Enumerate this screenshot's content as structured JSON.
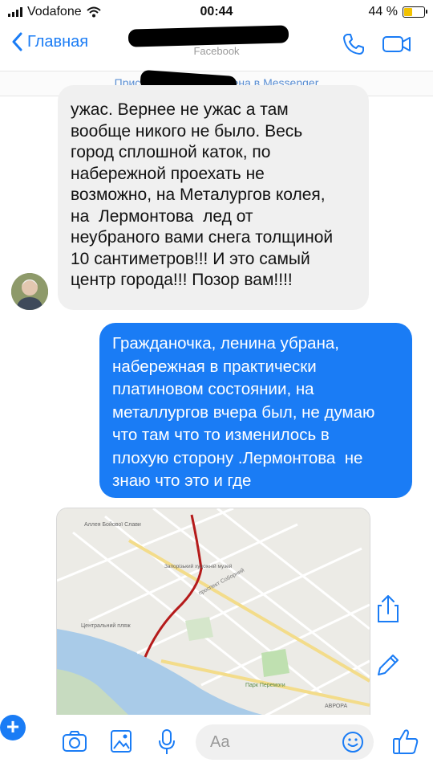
{
  "status_bar": {
    "carrier": "Vodafone",
    "time": "00:44",
    "battery": "44 %",
    "battery_level": 0.44
  },
  "nav": {
    "back_label": "Главная",
    "subtitle": "Facebook"
  },
  "banner": {
    "text": "Присоединяйтесь к Елена в Messenger"
  },
  "messages": {
    "incoming": [
      "ужас. Вернее не ужас а там",
      "вообще никого не было. Весь",
      "город сплошной каток, по",
      "набережной проехать не",
      "возможно, на Металургов колея,",
      "на  Лермонтова  лед от",
      "неубраного вами снега толщиной",
      "10 сантиметров!!! И это самый",
      "центр города!!! Позор вам!!!!"
    ],
    "outgoing": [
      "Гражданочка, ленина убрана,",
      "набережная в практически",
      "платиновом состоянии, на",
      "металлургов вчера был, не думаю",
      "что там что то изменилось в",
      "плохую сторону .Лермонтова  не",
      "знаю что это и где"
    ]
  },
  "map": {
    "labels": {
      "alley": "Аллея Бойової Слави",
      "center": "Центральний пляж",
      "avenue": "проспект Соборний",
      "park": "Парк Перемоги",
      "avrora": "АВРОРА",
      "museum": "Запорізький художній музей"
    }
  },
  "composer": {
    "placeholder": "Aa"
  }
}
